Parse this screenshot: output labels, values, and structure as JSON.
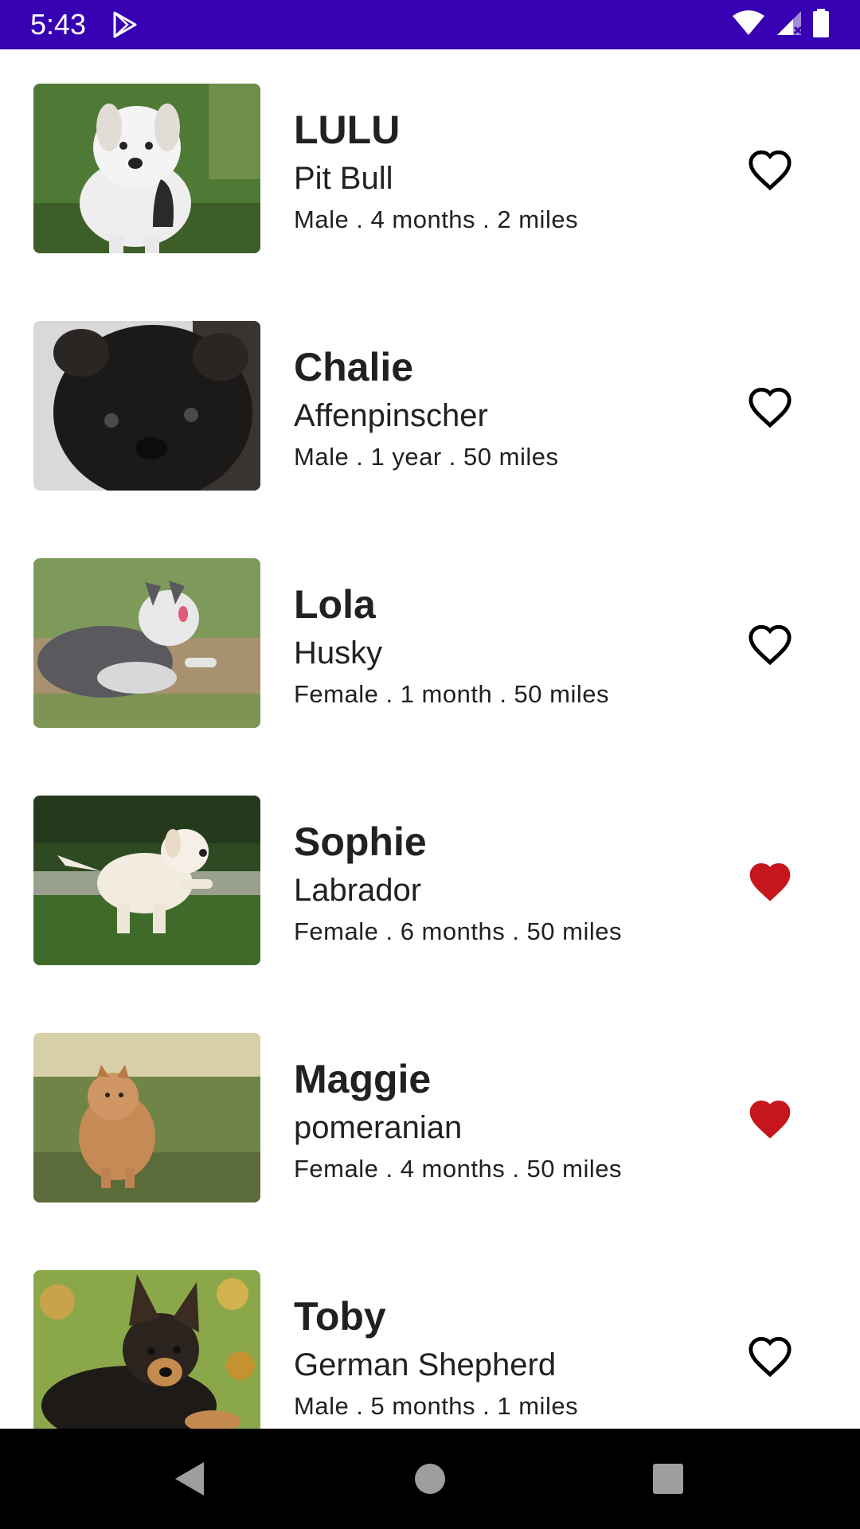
{
  "status_bar": {
    "time": "5:43",
    "background": "#3700b3",
    "icons": [
      "play-store-icon",
      "wifi-icon",
      "signal-icon",
      "battery-icon"
    ]
  },
  "colors": {
    "favorite_on": "#c4161c",
    "favorite_off": "#000000",
    "text": "#212121"
  },
  "pets": [
    {
      "name": "LULU",
      "breed": "Pit Bull",
      "details": "Male . 4 months . 2 miles",
      "favorite": false,
      "photo": "white pit bull puppy on grass"
    },
    {
      "name": "Chalie",
      "breed": "Affenpinscher",
      "details": "Male . 1 year . 50 miles",
      "favorite": false,
      "photo": "black affenpinscher puppy close-up"
    },
    {
      "name": "Lola",
      "breed": "Husky",
      "details": "Female . 1 month . 50 miles",
      "favorite": false,
      "photo": "husky puppy running on grass"
    },
    {
      "name": "Sophie",
      "breed": "Labrador",
      "details": "Female . 6 months . 50 miles",
      "favorite": true,
      "photo": "cream labrador puppy running on lawn"
    },
    {
      "name": "Maggie",
      "breed": "pomeranian",
      "details": "Female . 4 months . 50 miles",
      "favorite": true,
      "photo": "pomeranian puppy standing in field"
    },
    {
      "name": "Toby",
      "breed": "German Shepherd",
      "details": "Male . 5 months . 1 miles",
      "favorite": false,
      "photo": "german shepherd puppy lying in leaves"
    }
  ],
  "nav_bar": {
    "buttons": [
      "back-icon",
      "home-icon",
      "recents-icon"
    ]
  }
}
